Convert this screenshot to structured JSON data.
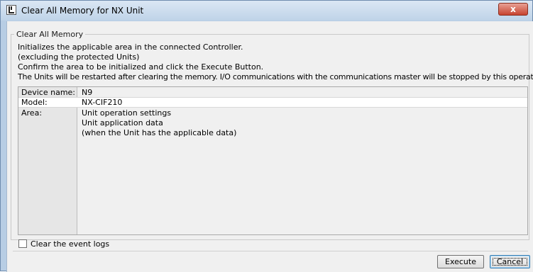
{
  "window": {
    "title": "Clear All Memory for NX Unit",
    "close_label": "x"
  },
  "group": {
    "legend": "Clear All Memory"
  },
  "description": {
    "line1": "Initializes the applicable area in the connected Controller.",
    "line2": "(excluding the protected Units)",
    "line3": "Confirm the area to be initialized and click the Execute Button.",
    "line4": "The Units will be restarted after clearing the memory. I/O communications with the communications master will be stopped by this operation."
  },
  "info": {
    "device_name_label": "Device name:",
    "device_name_value": "N9",
    "model_label": "Model:",
    "model_value": "NX-CIF210",
    "area_label": "Area:",
    "area_items": [
      "Unit operation settings",
      "Unit application data",
      "(when the Unit has the applicable data)"
    ]
  },
  "options": {
    "clear_event_logs_label": "Clear the event logs",
    "clear_event_logs_checked": false
  },
  "buttons": {
    "execute_label": "Execute",
    "cancel_label": "Cancel"
  },
  "colors": {
    "close_button": "#c7432f",
    "titlebar": "#bfd3e8",
    "dialog_background": "#f0f0f0"
  }
}
